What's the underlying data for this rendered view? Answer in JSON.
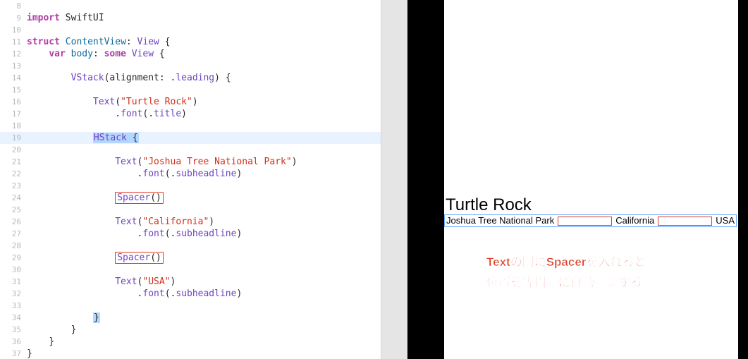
{
  "lines": [
    {
      "n": 8,
      "code": ""
    },
    {
      "n": 9,
      "code": "<span class='kw-pink'>import</span> <span class='plain'>SwiftUI</span>"
    },
    {
      "n": 10,
      "code": ""
    },
    {
      "n": 11,
      "code": "<span class='kw-pink'>struct</span> <span class='kw-blue'>ContentView</span><span class='plain'>: </span><span class='type-purple'>View</span><span class='plain'> {</span>"
    },
    {
      "n": 12,
      "code": "    <span class='kw-pink'>var</span> <span class='kw-blue'>body</span><span class='plain'>: </span><span class='kw-pink'>some</span> <span class='type-purple'>View</span><span class='plain'> {</span>"
    },
    {
      "n": 13,
      "code": ""
    },
    {
      "n": 14,
      "code": "        <span class='type-purple'>VStack</span><span class='plain'>(alignment: .</span><span class='dot-purple'>leading</span><span class='plain'>) {</span>"
    },
    {
      "n": 15,
      "code": ""
    },
    {
      "n": 16,
      "code": "            <span class='type-purple'>Text</span><span class='plain'>(</span><span class='str'>\"Turtle Rock\"</span><span class='plain'>)</span>"
    },
    {
      "n": 17,
      "code": "                <span class='plain'>.</span><span class='dot-purple'>font</span><span class='plain'>(.</span><span class='dot-purple'>title</span><span class='plain'>)</span>"
    },
    {
      "n": 18,
      "code": ""
    },
    {
      "n": 19,
      "hl": true,
      "code": "            <span class='sel-blue'><span class='type-purple'>HStack</span> <span class='plain'>{</span></span>"
    },
    {
      "n": 20,
      "code": ""
    },
    {
      "n": 21,
      "code": "                <span class='type-purple'>Text</span><span class='plain'>(</span><span class='str'>\"Joshua Tree National Park\"</span><span class='plain'>)</span>"
    },
    {
      "n": 22,
      "code": "                    <span class='plain'>.</span><span class='dot-purple'>font</span><span class='plain'>(.</span><span class='dot-purple'>subheadline</span><span class='plain'>)</span>"
    },
    {
      "n": 23,
      "code": ""
    },
    {
      "n": 24,
      "code": "                <span class='boxed'><span class='type-purple'>Spacer</span><span class='plain'>()</span></span>"
    },
    {
      "n": 25,
      "code": ""
    },
    {
      "n": 26,
      "code": "                <span class='type-purple'>Text</span><span class='plain'>(</span><span class='str'>\"California\"</span><span class='plain'>)</span>"
    },
    {
      "n": 27,
      "code": "                    <span class='plain'>.</span><span class='dot-purple'>font</span><span class='plain'>(.</span><span class='dot-purple'>subheadline</span><span class='plain'>)</span>"
    },
    {
      "n": 28,
      "code": ""
    },
    {
      "n": 29,
      "code": "                <span class='boxed'><span class='type-purple'>Spacer</span><span class='plain'>()</span></span>"
    },
    {
      "n": 30,
      "code": ""
    },
    {
      "n": 31,
      "code": "                <span class='type-purple'>Text</span><span class='plain'>(</span><span class='str'>\"USA\"</span><span class='plain'>)</span>"
    },
    {
      "n": 32,
      "code": "                    <span class='plain'>.</span><span class='dot-purple'>font</span><span class='plain'>(.</span><span class='dot-purple'>subheadline</span><span class='plain'>)</span>"
    },
    {
      "n": 33,
      "code": ""
    },
    {
      "n": 34,
      "code": "            <span class='sel-blue plain'>}</span>"
    },
    {
      "n": 35,
      "code": "        <span class='plain'>}</span>"
    },
    {
      "n": 36,
      "code": "    <span class='plain'>}</span>"
    },
    {
      "n": 37,
      "code": "<span class='plain'>}</span>"
    }
  ],
  "preview": {
    "title": "Turtle Rock",
    "hstack": {
      "t1": "Joshua Tree National Park",
      "t2": "California",
      "t3": "USA"
    },
    "annotation_line1": "Textの間にSpacerを入れると",
    "annotation_line2": "位置を等間隔に自動調整する"
  }
}
